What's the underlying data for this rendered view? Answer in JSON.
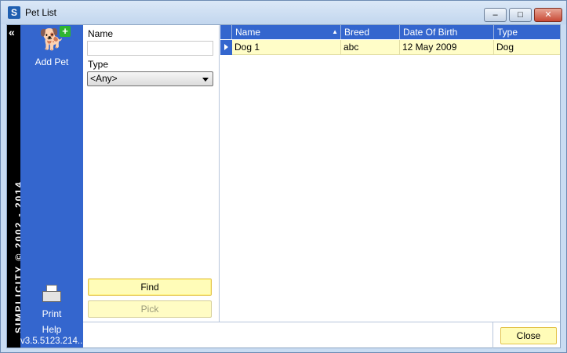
{
  "window": {
    "title": "Pet List",
    "app_icon_letter": "S",
    "minimize_glyph": "–",
    "maximize_glyph": "□",
    "close_glyph": "✕"
  },
  "brand": {
    "text": "SIMPLICITY © 2002 - 2014",
    "collapse_glyph": "«"
  },
  "sidebar": {
    "add_pet_label": "Add Pet",
    "add_pet_icon": "dog-icon",
    "add_plus": "+",
    "print_label": "Print",
    "print_icon": "printer-icon",
    "help_label": "Help",
    "version": "v3.5.5123.214..."
  },
  "filter": {
    "name_label": "Name",
    "name_value": "",
    "type_label": "Type",
    "type_selected": "<Any>",
    "find_label": "Find",
    "pick_label": "Pick"
  },
  "grid": {
    "columns": [
      "Name",
      "Breed",
      "Date Of Birth",
      "Type"
    ],
    "sort_indicator": "▲",
    "rows": [
      {
        "name": "Dog 1",
        "breed": "abc",
        "dob": "12 May 2009",
        "type": "Dog"
      }
    ]
  },
  "footer": {
    "close_label": "Close"
  },
  "colors": {
    "sidebar_blue": "#3466ce",
    "selected_row": "#fffdc8",
    "button_yellow": "#fffcb8"
  }
}
